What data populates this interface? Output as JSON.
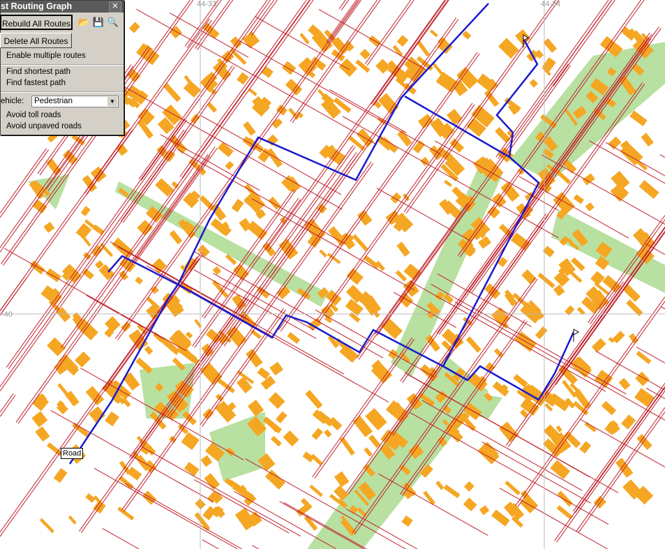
{
  "window": {
    "title": "st Routing Graph",
    "close": "✕"
  },
  "buttons": {
    "rebuild": "Rebuild All Routes",
    "delete": "Delete All Routes"
  },
  "tools": {
    "open": "📂",
    "save": "💾",
    "search": "🔍"
  },
  "options": {
    "multiple": "Enable multiple routes",
    "shortest": "Find shortest path",
    "fastest": "Find fastest path",
    "vehicle_label": "ehicle:",
    "vehicle_value": "Pedestrian",
    "toll": "Avoid toll roads",
    "unpaved": "Avoid unpaved roads"
  },
  "map": {
    "grid_labels": [
      "44-33",
      "44-34",
      "-40"
    ],
    "tooltip": "Road",
    "colors": {
      "route": "#1a1acc",
      "road": "#c0202a",
      "building": "#f5a623",
      "park": "#b8e0a0"
    }
  }
}
